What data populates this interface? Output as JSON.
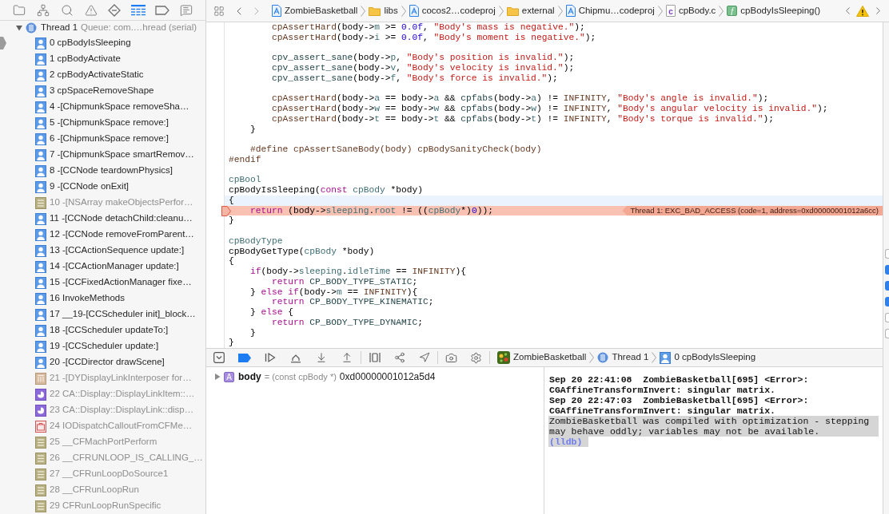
{
  "navigator": {
    "tabs": [
      {
        "selected": false
      },
      {
        "selected": false
      },
      {
        "selected": false
      },
      {
        "selected": false
      },
      {
        "selected": false
      },
      {
        "selected": true
      },
      {
        "selected": false
      },
      {
        "selected": false
      }
    ],
    "thread": {
      "label": "Thread 1",
      "queue": "Queue: com.…hread (serial)",
      "expanded": true
    },
    "frames": [
      {
        "label": "0 cpBodyIsSleeping",
        "kind": "user",
        "current": true
      },
      {
        "label": "1 cpBodyActivate",
        "kind": "user",
        "current": false
      },
      {
        "label": "2 cpBodyActivateStatic",
        "kind": "user",
        "current": false
      },
      {
        "label": "3 cpSpaceRemoveShape",
        "kind": "user",
        "current": false
      },
      {
        "label": "4 -[ChipmunkSpace removeSha…",
        "kind": "user",
        "current": false
      },
      {
        "label": "5 -[ChipmunkSpace remove:]",
        "kind": "user",
        "current": false
      },
      {
        "label": "6 -[ChipmunkSpace remove:]",
        "kind": "user",
        "current": false
      },
      {
        "label": "7 -[ChipmunkSpace smartRemov…",
        "kind": "user",
        "current": false
      },
      {
        "label": "8 -[CCNode teardownPhysics]",
        "kind": "user",
        "current": false
      },
      {
        "label": "9 -[CCNode onExit]",
        "kind": "user",
        "current": false
      },
      {
        "label": "10 -[NSArray makeObjectsPerfor…",
        "kind": "library",
        "current": false
      },
      {
        "label": "11 -[CCNode detachChild:cleanu…",
        "kind": "user",
        "current": false
      },
      {
        "label": "12 -[CCNode removeFromParent…",
        "kind": "user",
        "current": false
      },
      {
        "label": "13 -[CCActionSequence update:]",
        "kind": "user",
        "current": false
      },
      {
        "label": "14 -[CCActionManager update:]",
        "kind": "user",
        "current": false
      },
      {
        "label": "15 -[CCFixedActionManager fixe…",
        "kind": "user",
        "current": false
      },
      {
        "label": "16 InvokeMethods",
        "kind": "user",
        "current": false
      },
      {
        "label": "17 __19-[CCScheduler init]_block…",
        "kind": "user",
        "current": false
      },
      {
        "label": "18 -[CCScheduler updateTo:]",
        "kind": "user",
        "current": false
      },
      {
        "label": "19 -[CCScheduler update:]",
        "kind": "user",
        "current": false
      },
      {
        "label": "20 -[CCDirector drawScene]",
        "kind": "user",
        "current": false
      },
      {
        "label": "21 -[DYDisplayLinkInterposer for…",
        "kind": "interposer",
        "current": false
      },
      {
        "label": "22 CA::Display::DisplayLinkItem::…",
        "kind": "quartz",
        "current": false
      },
      {
        "label": "23 CA::Display::DisplayLink::disp…",
        "kind": "quartz",
        "current": false
      },
      {
        "label": "24 IODispatchCalloutFromCFMe…",
        "kind": "iokit",
        "current": false
      },
      {
        "label": "25 __CFMachPortPerform",
        "kind": "library",
        "current": false
      },
      {
        "label": "26 __CFRUNLOOP_IS_CALLING_…",
        "kind": "library",
        "current": false
      },
      {
        "label": "27 __CFRunLoopDoSource1",
        "kind": "library",
        "current": false
      },
      {
        "label": "28 __CFRunLoopRun",
        "kind": "library",
        "current": false
      },
      {
        "label": "29 CFRunLoopRunSpecific",
        "kind": "library",
        "current": false
      }
    ]
  },
  "jump_bar": {
    "items": [
      {
        "kind": "project",
        "label": "ZombieBasketball"
      },
      {
        "kind": "folder",
        "label": "libs"
      },
      {
        "kind": "project",
        "label": "cocos2…codeproj"
      },
      {
        "kind": "folder",
        "label": "external"
      },
      {
        "kind": "project",
        "label": "Chipmu…codeproj"
      },
      {
        "kind": "file",
        "badge": "c",
        "label": "cpBody.c"
      },
      {
        "kind": "function",
        "badge": "f",
        "label": "cpBodyIsSleeping()"
      }
    ]
  },
  "editor": {
    "lines": [
      {
        "kind": "plain",
        "tokens": [
          {
            "text": "        cpAssertHard",
            "kind": "macro"
          },
          {
            "text": "(body->",
            "kind": "plain"
          },
          {
            "text": "m",
            "kind": "type"
          },
          {
            "text": " >= ",
            "kind": "plain"
          },
          {
            "text": "0.0f",
            "kind": "number"
          },
          {
            "text": ", ",
            "kind": "plain"
          },
          {
            "text": "\"Body's mass is negative.\"",
            "kind": "string"
          },
          {
            "text": ");",
            "kind": "plain"
          }
        ]
      },
      {
        "kind": "plain",
        "tokens": [
          {
            "text": "        cpAssertHard",
            "kind": "macro"
          },
          {
            "text": "(body->",
            "kind": "plain"
          },
          {
            "text": "i",
            "kind": "type"
          },
          {
            "text": " >= ",
            "kind": "plain"
          },
          {
            "text": "0.0f",
            "kind": "number"
          },
          {
            "text": ", ",
            "kind": "plain"
          },
          {
            "text": "\"Body's moment is negative.\"",
            "kind": "string"
          },
          {
            "text": ");",
            "kind": "plain"
          }
        ]
      },
      {
        "kind": "blank"
      },
      {
        "kind": "plain",
        "tokens": [
          {
            "text": "        cpv_assert_sane",
            "kind": "function"
          },
          {
            "text": "(body->",
            "kind": "plain"
          },
          {
            "text": "p",
            "kind": "type"
          },
          {
            "text": ", ",
            "kind": "plain"
          },
          {
            "text": "\"Body's position is invalid.\"",
            "kind": "string"
          },
          {
            "text": ");",
            "kind": "plain"
          }
        ]
      },
      {
        "kind": "plain",
        "tokens": [
          {
            "text": "        cpv_assert_sane",
            "kind": "function"
          },
          {
            "text": "(body->",
            "kind": "plain"
          },
          {
            "text": "v",
            "kind": "type"
          },
          {
            "text": ", ",
            "kind": "plain"
          },
          {
            "text": "\"Body's velocity is invalid.\"",
            "kind": "string"
          },
          {
            "text": ");",
            "kind": "plain"
          }
        ]
      },
      {
        "kind": "plain",
        "tokens": [
          {
            "text": "        cpv_assert_sane",
            "kind": "function"
          },
          {
            "text": "(body->",
            "kind": "plain"
          },
          {
            "text": "f",
            "kind": "type"
          },
          {
            "text": ", ",
            "kind": "plain"
          },
          {
            "text": "\"Body's force is invalid.\"",
            "kind": "string"
          },
          {
            "text": ");",
            "kind": "plain"
          }
        ]
      },
      {
        "kind": "blank"
      },
      {
        "kind": "plain",
        "tokens": [
          {
            "text": "        cpAssertHard",
            "kind": "macro"
          },
          {
            "text": "(body->",
            "kind": "plain"
          },
          {
            "text": "a",
            "kind": "type"
          },
          {
            "text": " == body->",
            "kind": "plain"
          },
          {
            "text": "a",
            "kind": "type"
          },
          {
            "text": " && ",
            "kind": "plain"
          },
          {
            "text": "cpfabs",
            "kind": "function"
          },
          {
            "text": "(body->",
            "kind": "plain"
          },
          {
            "text": "a",
            "kind": "type"
          },
          {
            "text": ") != ",
            "kind": "plain"
          },
          {
            "text": "INFINITY",
            "kind": "macro"
          },
          {
            "text": ", ",
            "kind": "plain"
          },
          {
            "text": "\"Body's angle is invalid.\"",
            "kind": "string"
          },
          {
            "text": ");",
            "kind": "plain"
          }
        ]
      },
      {
        "kind": "plain",
        "tokens": [
          {
            "text": "        cpAssertHard",
            "kind": "macro"
          },
          {
            "text": "(body->",
            "kind": "plain"
          },
          {
            "text": "w",
            "kind": "type"
          },
          {
            "text": " == body->",
            "kind": "plain"
          },
          {
            "text": "w",
            "kind": "type"
          },
          {
            "text": " && ",
            "kind": "plain"
          },
          {
            "text": "cpfabs",
            "kind": "function"
          },
          {
            "text": "(body->",
            "kind": "plain"
          },
          {
            "text": "w",
            "kind": "type"
          },
          {
            "text": ") != ",
            "kind": "plain"
          },
          {
            "text": "INFINITY",
            "kind": "macro"
          },
          {
            "text": ", ",
            "kind": "plain"
          },
          {
            "text": "\"Body's angular velocity is invalid.\"",
            "kind": "string"
          },
          {
            "text": ");",
            "kind": "plain"
          }
        ]
      },
      {
        "kind": "plain",
        "tokens": [
          {
            "text": "        cpAssertHard",
            "kind": "macro"
          },
          {
            "text": "(body->",
            "kind": "plain"
          },
          {
            "text": "t",
            "kind": "type"
          },
          {
            "text": " == body->",
            "kind": "plain"
          },
          {
            "text": "t",
            "kind": "type"
          },
          {
            "text": " && ",
            "kind": "plain"
          },
          {
            "text": "cpfabs",
            "kind": "function"
          },
          {
            "text": "(body->",
            "kind": "plain"
          },
          {
            "text": "t",
            "kind": "type"
          },
          {
            "text": ") != ",
            "kind": "plain"
          },
          {
            "text": "INFINITY",
            "kind": "macro"
          },
          {
            "text": ", ",
            "kind": "plain"
          },
          {
            "text": "\"Body's torque is invalid.\"",
            "kind": "string"
          },
          {
            "text": ");",
            "kind": "plain"
          }
        ]
      },
      {
        "kind": "plain",
        "tokens": [
          {
            "text": "    }",
            "kind": "plain"
          }
        ]
      },
      {
        "kind": "blank"
      },
      {
        "kind": "plain",
        "tokens": [
          {
            "text": "    #define cpAssertSaneBody(body) cpBodySanityCheck(body)",
            "kind": "macro"
          }
        ]
      },
      {
        "kind": "plain",
        "tokens": [
          {
            "text": "#endif",
            "kind": "macro"
          }
        ]
      },
      {
        "kind": "blank"
      },
      {
        "kind": "plain",
        "tokens": [
          {
            "text": "cpBool",
            "kind": "type"
          }
        ]
      },
      {
        "kind": "plain",
        "tokens": [
          {
            "text": "cpBodyIsSleeping(",
            "kind": "plain"
          },
          {
            "text": "const",
            "kind": "keyword"
          },
          {
            "text": " cpBody",
            "kind": "type"
          },
          {
            "text": " *body)",
            "kind": "plain"
          }
        ]
      },
      {
        "kind": "caret",
        "tokens": [
          {
            "text": "{",
            "kind": "plain"
          }
        ]
      },
      {
        "kind": "error",
        "message": "Thread 1: EXC_BAD_ACCESS (code=1, address=0xd00000001012a6cc)",
        "tokens": [
          {
            "text": "    return",
            "kind": "keyword"
          },
          {
            "text": " (body->",
            "kind": "plain"
          },
          {
            "text": "sleeping",
            "kind": "type"
          },
          {
            "text": ".",
            "kind": "plain"
          },
          {
            "text": "root",
            "kind": "type"
          },
          {
            "text": " != ((",
            "kind": "plain"
          },
          {
            "text": "cpBody",
            "kind": "type"
          },
          {
            "text": "*)",
            "kind": "plain"
          },
          {
            "text": "0",
            "kind": "number"
          },
          {
            "text": "));",
            "kind": "plain"
          }
        ]
      },
      {
        "kind": "plain",
        "tokens": [
          {
            "text": "}",
            "kind": "plain"
          }
        ]
      },
      {
        "kind": "blank"
      },
      {
        "kind": "plain",
        "tokens": [
          {
            "text": "cpBodyType",
            "kind": "type"
          }
        ]
      },
      {
        "kind": "plain",
        "tokens": [
          {
            "text": "cpBodyGetType(",
            "kind": "plain"
          },
          {
            "text": "cpBody",
            "kind": "type"
          },
          {
            "text": " *body)",
            "kind": "plain"
          }
        ]
      },
      {
        "kind": "plain",
        "tokens": [
          {
            "text": "{",
            "kind": "plain"
          }
        ]
      },
      {
        "kind": "plain",
        "tokens": [
          {
            "text": "    if",
            "kind": "keyword"
          },
          {
            "text": "(body->",
            "kind": "plain"
          },
          {
            "text": "sleeping",
            "kind": "type"
          },
          {
            "text": ".",
            "kind": "plain"
          },
          {
            "text": "idleTime",
            "kind": "type"
          },
          {
            "text": " == ",
            "kind": "plain"
          },
          {
            "text": "INFINITY",
            "kind": "macro"
          },
          {
            "text": "){",
            "kind": "plain"
          }
        ]
      },
      {
        "kind": "plain",
        "tokens": [
          {
            "text": "        return",
            "kind": "keyword"
          },
          {
            "text": " CP_BODY_TYPE_STATIC",
            "kind": "function"
          },
          {
            "text": ";",
            "kind": "plain"
          }
        ]
      },
      {
        "kind": "plain",
        "tokens": [
          {
            "text": "    } ",
            "kind": "plain"
          },
          {
            "text": "else if",
            "kind": "keyword"
          },
          {
            "text": "(body->",
            "kind": "plain"
          },
          {
            "text": "m",
            "kind": "type"
          },
          {
            "text": " == ",
            "kind": "plain"
          },
          {
            "text": "INFINITY",
            "kind": "macro"
          },
          {
            "text": "){",
            "kind": "plain"
          }
        ]
      },
      {
        "kind": "plain",
        "tokens": [
          {
            "text": "        return",
            "kind": "keyword"
          },
          {
            "text": " CP_BODY_TYPE_KINEMATIC",
            "kind": "function"
          },
          {
            "text": ";",
            "kind": "plain"
          }
        ]
      },
      {
        "kind": "plain",
        "tokens": [
          {
            "text": "    } ",
            "kind": "plain"
          },
          {
            "text": "else",
            "kind": "keyword"
          },
          {
            "text": " {",
            "kind": "plain"
          }
        ]
      },
      {
        "kind": "plain",
        "tokens": [
          {
            "text": "        return",
            "kind": "keyword"
          },
          {
            "text": " CP_BODY_TYPE_DYNAMIC",
            "kind": "function"
          },
          {
            "text": ";",
            "kind": "plain"
          }
        ]
      },
      {
        "kind": "plain",
        "tokens": [
          {
            "text": "    }",
            "kind": "plain"
          }
        ]
      },
      {
        "kind": "plain",
        "tokens": [
          {
            "text": "}",
            "kind": "plain"
          }
        ]
      }
    ]
  },
  "debug_bar": {
    "breakpoints_active": true,
    "path": [
      {
        "kind": "app",
        "label": "ZombieBasketball"
      },
      {
        "kind": "thread",
        "label": "Thread 1"
      },
      {
        "kind": "frame",
        "label": "0 cpBodyIsSleeping"
      }
    ]
  },
  "variables": [
    {
      "badge": "A",
      "name": "body",
      "type": "= (const cpBody *)",
      "value": "0xd00000001012a5d4",
      "expanded": false
    }
  ],
  "console": {
    "lines": [
      {
        "kind": "log",
        "selected": false,
        "text": "Sep 20 22:41:08  ZombieBasketball[695] <Error>:"
      },
      {
        "kind": "log",
        "selected": false,
        "text": "CGAffineTransformInvert: singular matrix."
      },
      {
        "kind": "log",
        "selected": false,
        "text": "Sep 20 22:47:03  ZombieBasketball[695] <Error>:"
      },
      {
        "kind": "log",
        "selected": false,
        "text": "CGAffineTransformInvert: singular matrix."
      },
      {
        "kind": "message",
        "selected": true,
        "text": "ZombieBasketball was compiled with optimization - stepping"
      },
      {
        "kind": "message",
        "selected": true,
        "text": "may behave oddly; variables may not be available."
      },
      {
        "kind": "prompt",
        "selected": true,
        "text": "(lldb)"
      }
    ]
  },
  "inspector_edge": {
    "checkboxes": [
      {
        "checked": false
      },
      {
        "checked": true
      },
      {
        "checked": true
      },
      {
        "checked": true
      },
      {
        "checked": false
      },
      {
        "checked": false
      }
    ]
  }
}
